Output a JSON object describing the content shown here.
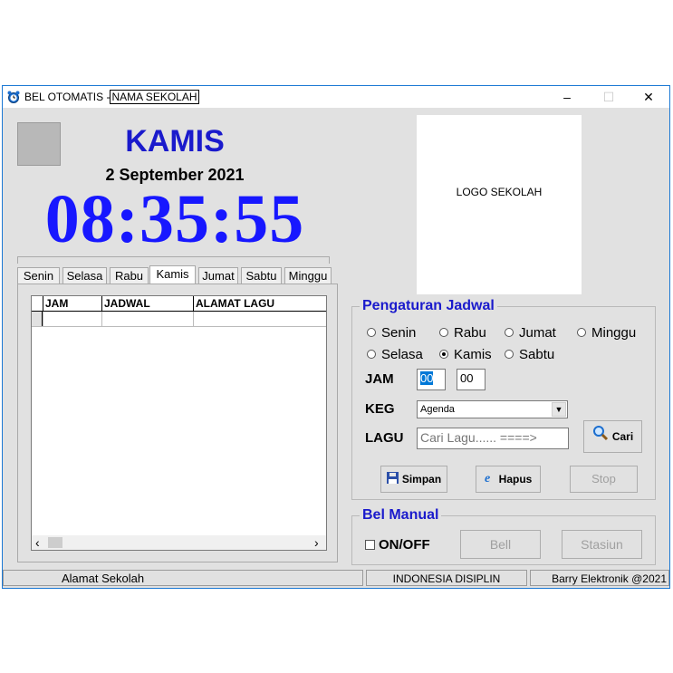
{
  "window": {
    "title_prefix": "BEL OTOMATIS -",
    "title_school": "NAMA SEKOLAH",
    "minimize": "–",
    "maximize": "☐",
    "close": "✕",
    "border_color": "#1b78d4"
  },
  "clock": {
    "day": "KAMIS",
    "date": "2 September 2021",
    "time": "08:35:55",
    "accent_color": "#1717ff"
  },
  "tabs": {
    "items": [
      "Senin",
      "Selasa",
      "Rabu",
      "Kamis",
      "Jumat",
      "Sabtu",
      "Minggu"
    ],
    "active": "Kamis"
  },
  "grid": {
    "columns": [
      "JAM",
      "JADWAL",
      "ALAMAT LAGU"
    ],
    "rows": [],
    "scroll_left": "‹",
    "scroll_right": "›"
  },
  "logo": {
    "text": "LOGO SEKOLAH"
  },
  "pengaturan": {
    "title": "Pengaturan Jadwal",
    "days": [
      "Senin",
      "Rabu",
      "Jumat",
      "Minggu",
      "Selasa",
      "Kamis",
      "Sabtu"
    ],
    "selected_day": "Kamis",
    "jam_label": "JAM",
    "jam_hour": "00",
    "jam_minute": "00",
    "keg_label": "KEG",
    "keg_value": "Agenda",
    "lagu_label": "LAGU",
    "lagu_placeholder": "Cari Lagu...... ====>",
    "cari_button": "Cari",
    "simpan_button": "Simpan",
    "hapus_button": "Hapus",
    "stop_button": "Stop"
  },
  "bel_manual": {
    "title": "Bel Manual",
    "onoff_label": "ON/OFF",
    "bell_button": "Bell",
    "stasiun_button": "Stasiun"
  },
  "statusbar": {
    "address": "Alamat Sekolah",
    "motto": "INDONESIA DISIPLIN",
    "credit": "Barry Elektronik @2021"
  }
}
